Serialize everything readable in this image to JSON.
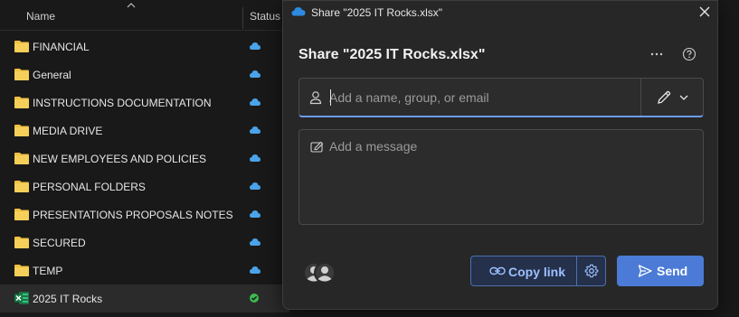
{
  "explorer": {
    "columns": {
      "name": "Name",
      "status": "Status"
    },
    "items": [
      {
        "name": "FINANCIAL",
        "type": "folder",
        "status": "cloud"
      },
      {
        "name": "General",
        "type": "folder",
        "status": "cloud"
      },
      {
        "name": "INSTRUCTIONS DOCUMENTATION",
        "type": "folder",
        "status": "cloud"
      },
      {
        "name": "MEDIA DRIVE",
        "type": "folder",
        "status": "cloud"
      },
      {
        "name": "NEW EMPLOYEES AND POLICIES",
        "type": "folder",
        "status": "cloud"
      },
      {
        "name": "PERSONAL FOLDERS",
        "type": "folder",
        "status": "cloud"
      },
      {
        "name": "PRESENTATIONS PROPOSALS NOTES",
        "type": "folder",
        "status": "cloud"
      },
      {
        "name": "SECURED",
        "type": "folder",
        "status": "cloud"
      },
      {
        "name": "TEMP",
        "type": "folder",
        "status": "cloud"
      },
      {
        "name": "2025 IT Rocks",
        "type": "excel",
        "status": "synced",
        "selected": true
      }
    ]
  },
  "dialog": {
    "window_title": "Share \"2025 IT Rocks.xlsx\"",
    "heading": "Share \"2025 IT Rocks.xlsx\"",
    "people_placeholder": "Add a name, group, or email",
    "people_value": "",
    "message_placeholder": "Add a message",
    "message_value": "",
    "copy_link_label": "Copy link",
    "send_label": "Send"
  },
  "icons": {
    "folder": "folder-icon",
    "excel": "excel-file-icon",
    "cloud": "cloud-only-icon",
    "synced": "synced-check-icon",
    "onedrive": "onedrive-icon",
    "close": "close-icon",
    "more": "more-options-icon",
    "help": "help-icon",
    "person": "person-icon",
    "permission": "pencil-edit-icon",
    "message": "message-edit-icon",
    "link": "link-icon",
    "settings": "gear-icon",
    "send": "send-icon"
  },
  "colors": {
    "folder": "#f0c040",
    "cloud": "#4aa3ea",
    "synced": "#3fb950",
    "accent": "#4b7bd6",
    "link_text": "#9cc0ff"
  }
}
